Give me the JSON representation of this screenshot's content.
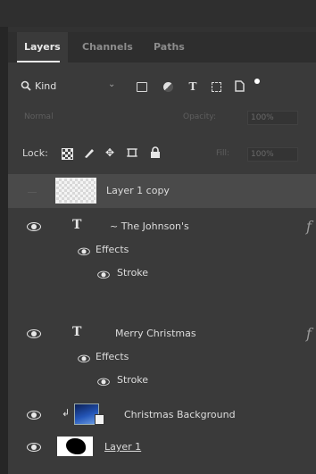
{
  "tabs": [
    "Layers",
    "Channels",
    "Paths"
  ],
  "filter": {
    "kind_label": "Kind"
  },
  "blend": {
    "mode": "Normal",
    "opacity_label": "Opacity:",
    "opacity_value": "100%"
  },
  "lock": {
    "label": "Lock:",
    "fill_label": "Fill:",
    "fill_value": "100%"
  },
  "layers": [
    {
      "name": "Layer 1 copy"
    },
    {
      "name": "~ The Johnson's",
      "fx": "f",
      "effects_label": "Effects",
      "stroke_label": "Stroke"
    },
    {
      "name": "Merry Christmas",
      "fx": "f",
      "effects_label": "Effects",
      "stroke_label": "Stroke"
    },
    {
      "name": "Christmas Background"
    },
    {
      "name": "Layer 1"
    }
  ],
  "icons": {
    "text_layer": "T",
    "search": "🔍",
    "brush": "✎",
    "move": "✥",
    "lock": "🔒"
  }
}
